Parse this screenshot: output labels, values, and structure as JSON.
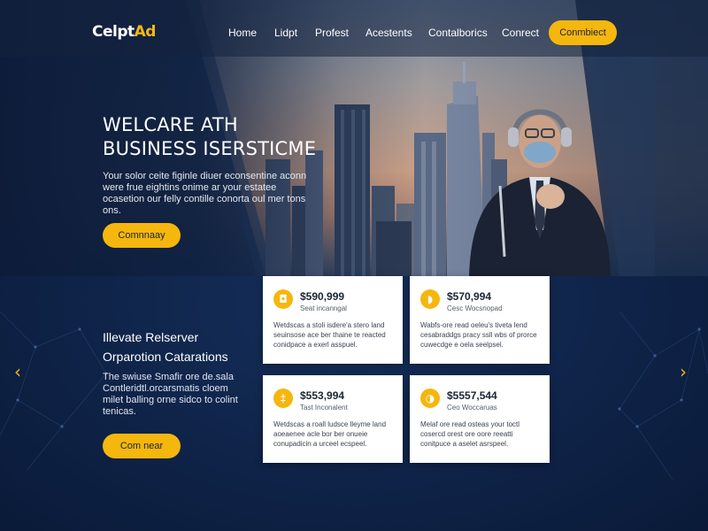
{
  "nav": {
    "logo_main": "CelptAd",
    "links": [
      "Home",
      "Lidpt",
      "Profest",
      "Acestents",
      "Contalborics",
      "Conrect"
    ],
    "cta": "Conmbiect"
  },
  "hero": {
    "title_line1": "WELCARE ATH",
    "title_line2": "BUSINESS ISERSTICME",
    "text": "Your solor ceite figinle diuer econsentine aconn were frue eightins onime ar your estatee ocasetion our felly contille conorta oul mer tons ons.",
    "button": "Comnnaay"
  },
  "section": {
    "title_line1": "Illevate Relserver",
    "title_line2": "Orparotion Catarations",
    "text": "The swiuse Smafir ore de.sala Contleridtl.orcarsmatis cloem milet balling orne sidco to colint tenicas.",
    "button": "Com near"
  },
  "cards": [
    {
      "icon": "◘",
      "value": "$590,999",
      "sub": "Seat incanngal",
      "text": "Wetdscas a stoli isdere'a stero land seuinsose ace ber thaine te reacted conidpace a exerl asspuel."
    },
    {
      "icon": "◗",
      "value": "$570,994",
      "sub": "Cesc Wocsnopad",
      "text": "Wabfs-ore read oeleu's tiveta lend cesabraddgs pracy ssll wbs of prorce cuwecdge e oela seelpsel."
    },
    {
      "icon": "‡",
      "value": "$553,994",
      "sub": "Tast Inconalent",
      "text": "Wetdscas a roall ludsce lleyme land aoeaenee acle bor ber onueie conupadicin a urceel ecspeel."
    },
    {
      "icon": "◑",
      "value": "$5557,544",
      "sub": "Ceo Woccaruas",
      "text": "Melaf ore read osteas your toctl cosercd orest ore oore reeatti conitpuce a aselet asrspeel."
    }
  ],
  "colors": {
    "accent": "#f5b70d",
    "navy": "#0f2348"
  }
}
